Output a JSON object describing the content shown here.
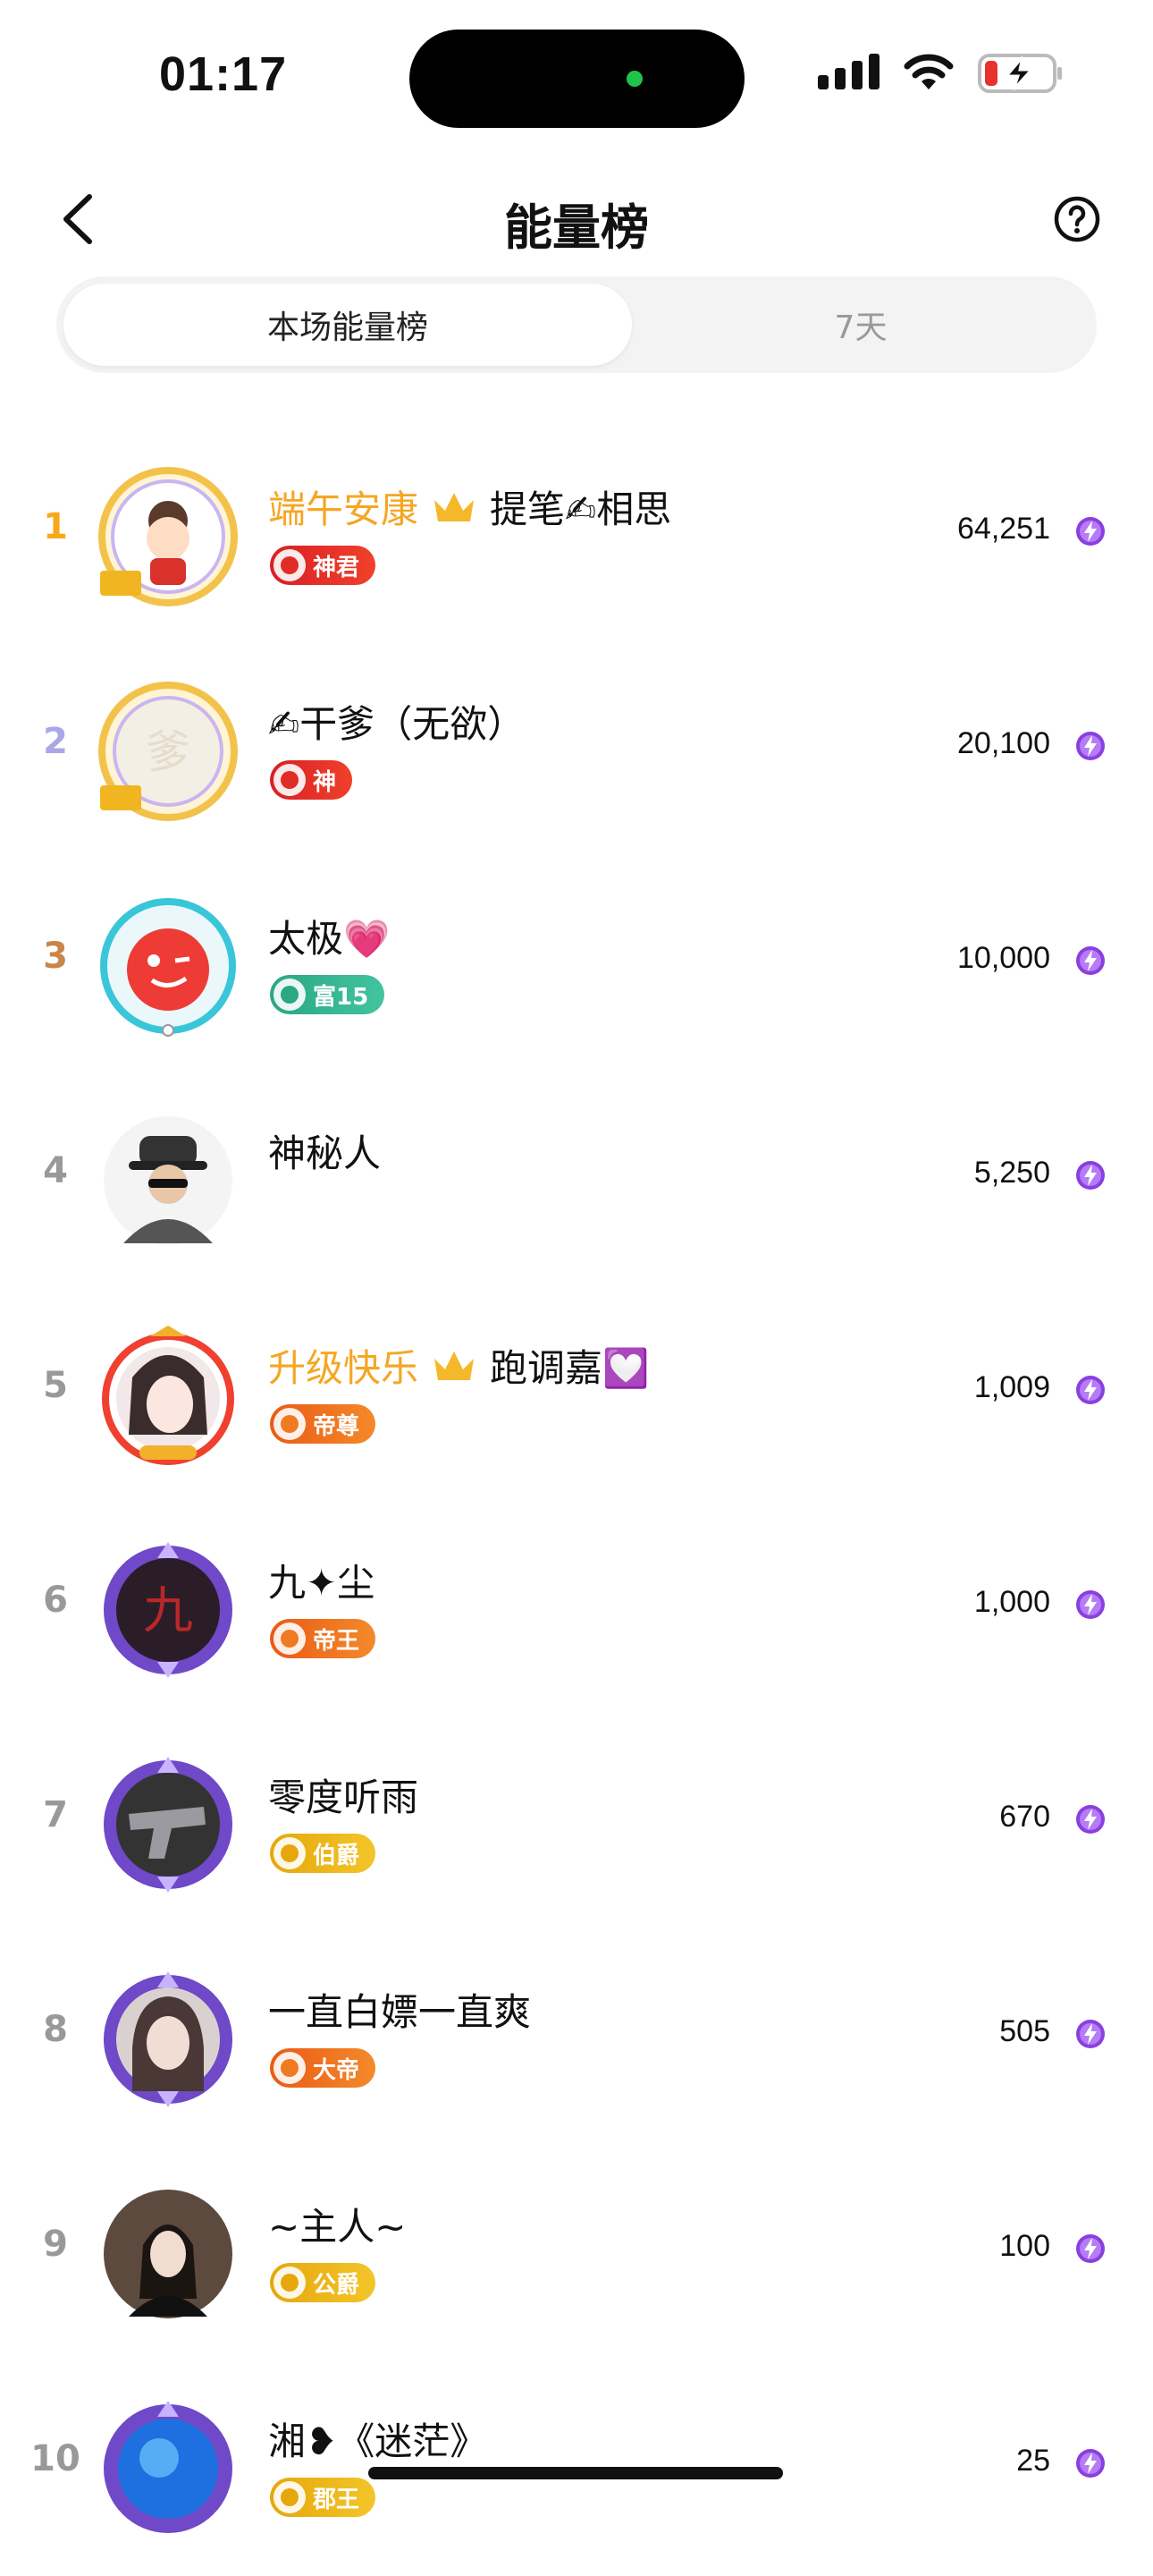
{
  "status_bar": {
    "time": "01:17"
  },
  "header": {
    "title": "能量榜"
  },
  "tabs": [
    {
      "label": "本场能量榜",
      "active": true
    },
    {
      "label": "7天",
      "active": false
    }
  ],
  "colors": {
    "gold": "#f5a623",
    "energy": "#8a3fe0",
    "badge_red": "#e02d26",
    "badge_orange": "#f07a22",
    "badge_gold": "#ecb81a",
    "badge_green": "#36b893"
  },
  "rows": [
    {
      "rank": "1",
      "name_highlight": "端午安康",
      "has_crown": true,
      "name": "提笔✍相思",
      "badge": "神君",
      "badge_color": "red",
      "score": "64,251",
      "avatar_icon": "cartoon-girl-avatar"
    },
    {
      "rank": "2",
      "name_highlight": "",
      "has_crown": false,
      "name": "✍干爹（无欲）",
      "badge": "神",
      "badge_color": "red",
      "score": "20,100",
      "avatar_icon": "calligraphy-avatar"
    },
    {
      "rank": "3",
      "name_highlight": "",
      "has_crown": false,
      "name": "太极💗",
      "badge": "富15",
      "badge_color": "green",
      "score": "10,000",
      "avatar_icon": "red-wink-face-avatar"
    },
    {
      "rank": "4",
      "name_highlight": "",
      "has_crown": false,
      "name": "神秘人",
      "badge": "",
      "badge_color": "",
      "score": "5,250",
      "avatar_icon": "mystery-man-avatar"
    },
    {
      "rank": "5",
      "name_highlight": "升级快乐",
      "has_crown": true,
      "name": "跑调嘉💟",
      "badge": "帝尊",
      "badge_color": "orange",
      "score": "1,009",
      "avatar_icon": "anime-girl-avatar"
    },
    {
      "rank": "6",
      "name_highlight": "",
      "has_crown": false,
      "name": "九✦尘",
      "badge": "帝王",
      "badge_color": "orange",
      "score": "1,000",
      "avatar_icon": "calligraphy-dark-avatar"
    },
    {
      "rank": "7",
      "name_highlight": "",
      "has_crown": false,
      "name": "零度听雨",
      "badge": "伯爵",
      "badge_color": "gold",
      "score": "670",
      "avatar_icon": "pistol-avatar"
    },
    {
      "rank": "8",
      "name_highlight": "",
      "has_crown": false,
      "name": "一直白嫖一直爽",
      "badge": "大帝",
      "badge_color": "orange",
      "score": "505",
      "avatar_icon": "woman-portrait-avatar"
    },
    {
      "rank": "9",
      "name_highlight": "",
      "has_crown": false,
      "name": "~主人~",
      "badge": "公爵",
      "badge_color": "gold",
      "score": "100",
      "avatar_icon": "woman-photo-avatar"
    },
    {
      "rank": "10",
      "name_highlight": "",
      "has_crown": false,
      "name": "湘❥《迷茫》",
      "badge": "郡王",
      "badge_color": "gold",
      "score": "25",
      "avatar_icon": "blue-orb-avatar"
    }
  ]
}
